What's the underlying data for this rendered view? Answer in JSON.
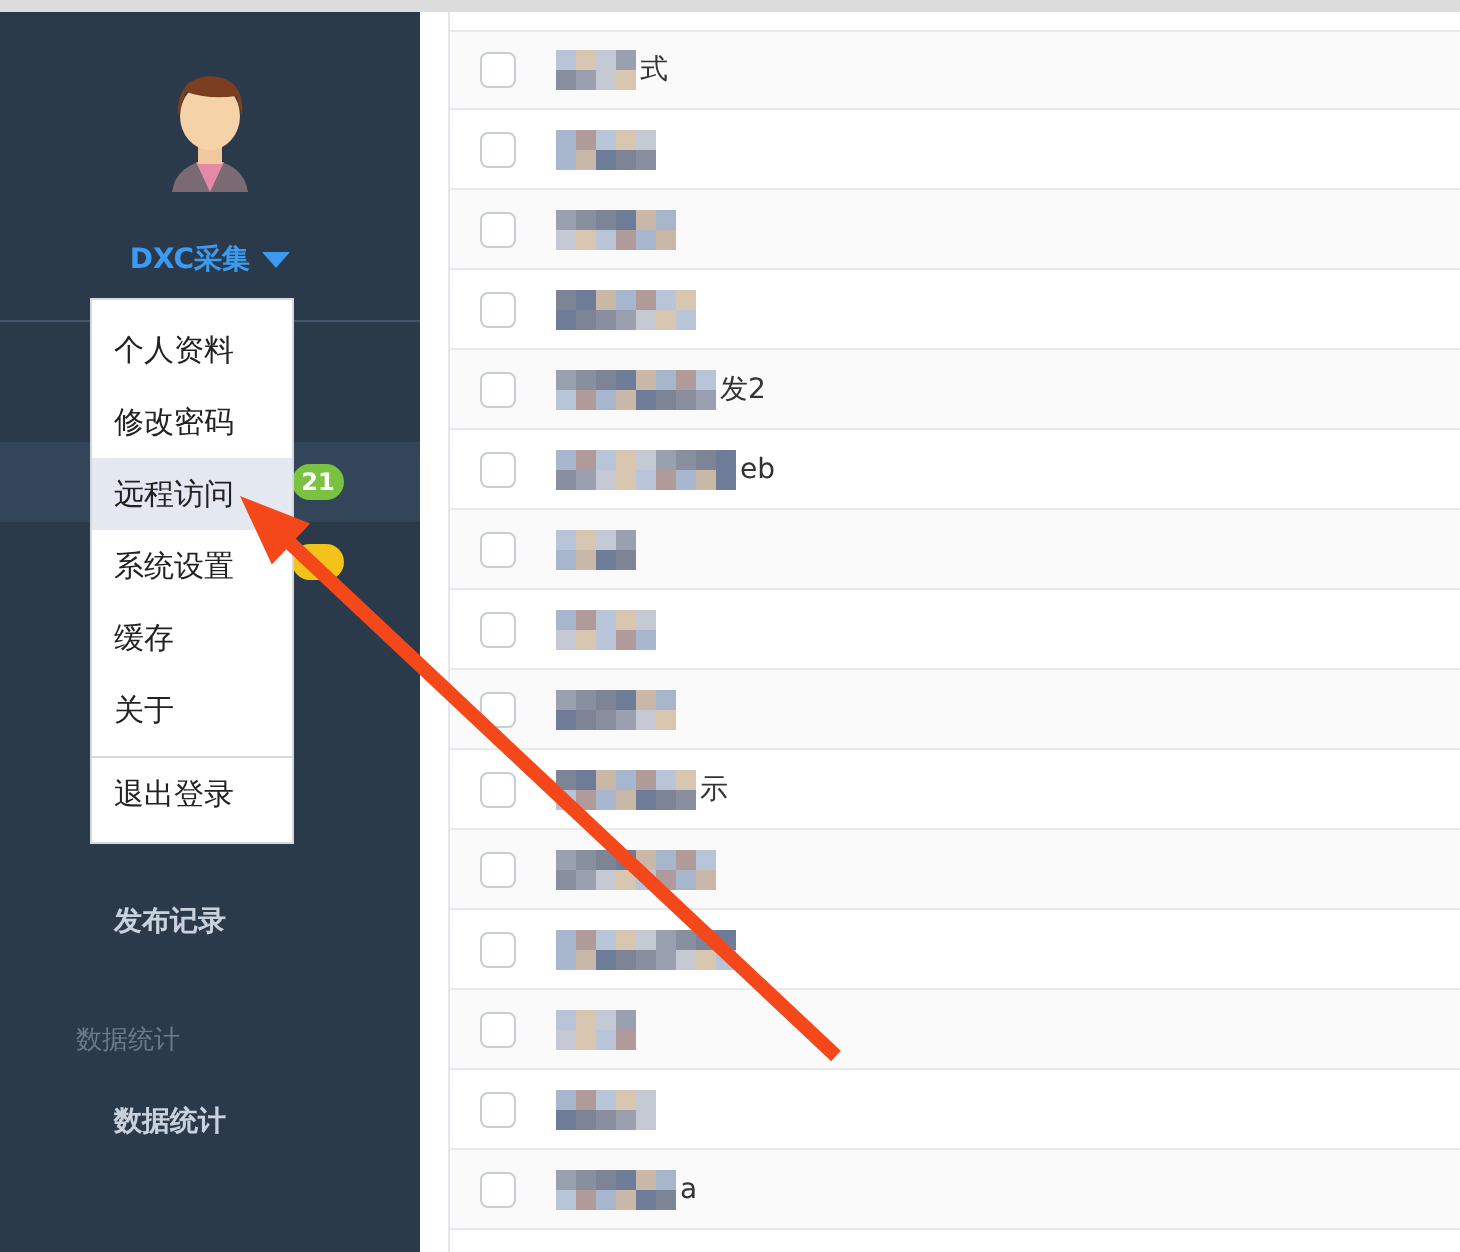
{
  "sidebar": {
    "user": {
      "name": "DXC采集"
    },
    "nav": [
      {
        "kind": "section"
      },
      {
        "kind": "item",
        "selected": true,
        "badge": {
          "text": "21",
          "color": "#7cc242"
        }
      },
      {
        "kind": "item",
        "selected": false,
        "badge": {
          "color": "#f2c31a"
        }
      },
      {
        "kind": "section"
      },
      {
        "kind": "item",
        "selected": false
      },
      {
        "kind": "item",
        "selected": false
      },
      {
        "kind": "item",
        "selected": false,
        "label": "发布记录"
      },
      {
        "kind": "section",
        "label": "数据统计"
      },
      {
        "kind": "item",
        "selected": false,
        "label": "数据统计"
      }
    ]
  },
  "user_menu": {
    "items": [
      {
        "label": "个人资料",
        "selected": false
      },
      {
        "label": "修改密码",
        "selected": false
      },
      {
        "label": "远程访问",
        "selected": true
      },
      {
        "label": "系统设置",
        "selected": false
      },
      {
        "label": "缓存",
        "selected": false
      },
      {
        "label": "关于",
        "selected": false
      },
      {
        "kind": "divider"
      },
      {
        "label": "退出登录",
        "selected": false
      }
    ]
  },
  "list": {
    "rows": [
      {
        "checked": false,
        "text": "式"
      },
      {
        "checked": false
      },
      {
        "checked": false
      },
      {
        "checked": false
      },
      {
        "checked": false,
        "text": "发2"
      },
      {
        "checked": false,
        "text": "eb"
      },
      {
        "checked": false
      },
      {
        "checked": false
      },
      {
        "checked": false
      },
      {
        "checked": false,
        "text": "示"
      },
      {
        "checked": false
      },
      {
        "checked": false
      },
      {
        "checked": false
      },
      {
        "checked": false
      },
      {
        "checked": false,
        "text": "a"
      }
    ]
  }
}
